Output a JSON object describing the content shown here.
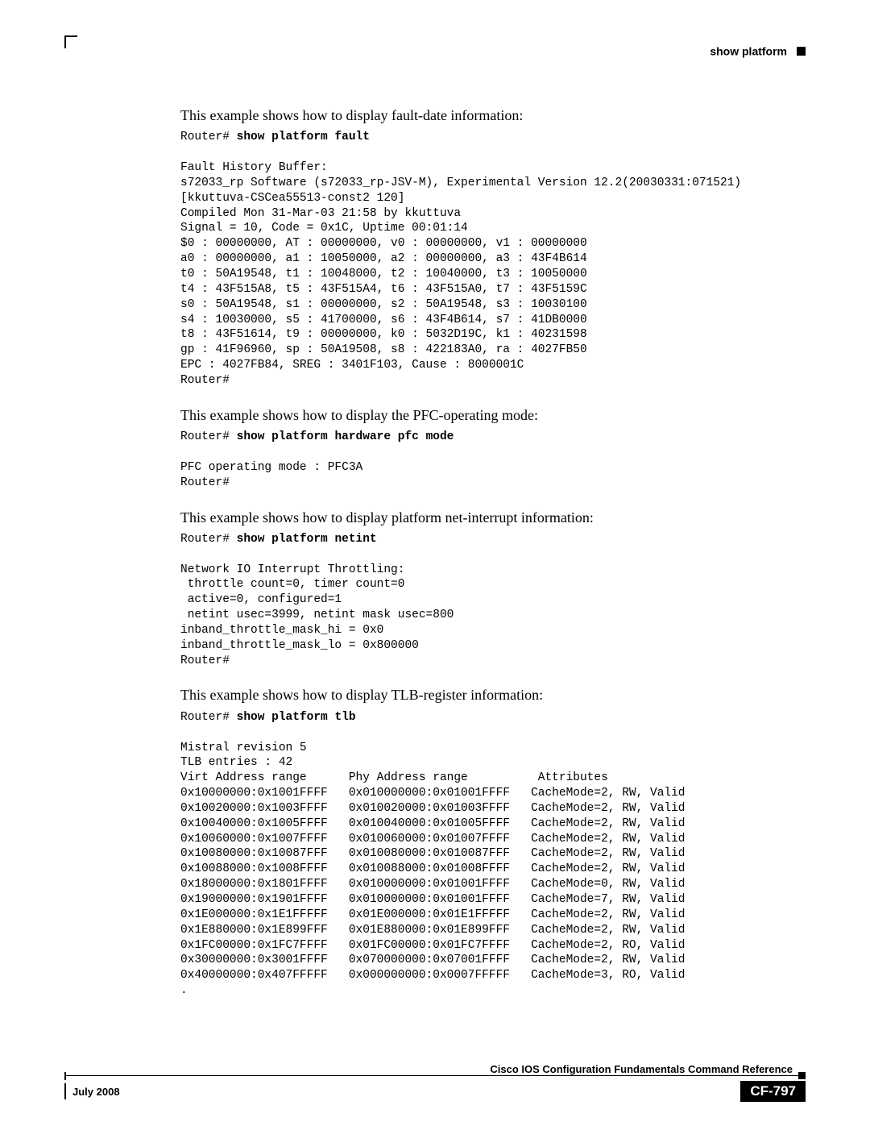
{
  "header": {
    "section": "show platform"
  },
  "paras": {
    "p1": "This example shows how to display fault-date information:",
    "p2": "This example shows how to display the PFC-operating mode:",
    "p3": "This example shows how to display platform net-interrupt information:",
    "p4": "This example shows how to display TLB-register information:"
  },
  "cmds": {
    "c1_prompt": "Router# ",
    "c1_bold": "show platform fault",
    "c2_prompt": "Router# ",
    "c2_bold": "show platform hardware pfc mode",
    "c3_prompt": "Router# ",
    "c3_bold": "show platform netint",
    "c4_prompt": "Router# ",
    "c4_bold": "show platform tlb"
  },
  "outputs": {
    "o1": "Fault History Buffer:\ns72033_rp Software (s72033_rp-JSV-M), Experimental Version 12.2(20030331:071521)\n[kkuttuva-CSCea55513-const2 120]\nCompiled Mon 31-Mar-03 21:58 by kkuttuva\nSignal = 10, Code = 0x1C, Uptime 00:01:14\n$0 : 00000000, AT : 00000000, v0 : 00000000, v1 : 00000000\na0 : 00000000, a1 : 10050000, a2 : 00000000, a3 : 43F4B614\nt0 : 50A19548, t1 : 10048000, t2 : 10040000, t3 : 10050000\nt4 : 43F515A8, t5 : 43F515A4, t6 : 43F515A0, t7 : 43F5159C\ns0 : 50A19548, s1 : 00000000, s2 : 50A19548, s3 : 10030100\ns4 : 10030000, s5 : 41700000, s6 : 43F4B614, s7 : 41DB0000\nt8 : 43F51614, t9 : 00000000, k0 : 5032D19C, k1 : 40231598\ngp : 41F96960, sp : 50A19508, s8 : 422183A0, ra : 4027FB50\nEPC : 4027FB84, SREG : 3401F103, Cause : 8000001C\nRouter#",
    "o2": "PFC operating mode : PFC3A\nRouter#",
    "o3": "Network IO Interrupt Throttling:\n throttle count=0, timer count=0\n active=0, configured=1\n netint usec=3999, netint mask usec=800\ninband_throttle_mask_hi = 0x0\ninband_throttle_mask_lo = 0x800000\nRouter#",
    "o4": "Mistral revision 5\nTLB entries : 42\nVirt Address range      Phy Address range          Attributes\n0x10000000:0x1001FFFF   0x010000000:0x01001FFFF   CacheMode=2, RW, Valid\n0x10020000:0x1003FFFF   0x010020000:0x01003FFFF   CacheMode=2, RW, Valid\n0x10040000:0x1005FFFF   0x010040000:0x01005FFFF   CacheMode=2, RW, Valid\n0x10060000:0x1007FFFF   0x010060000:0x01007FFFF   CacheMode=2, RW, Valid\n0x10080000:0x10087FFF   0x010080000:0x010087FFF   CacheMode=2, RW, Valid\n0x10088000:0x1008FFFF   0x010088000:0x01008FFFF   CacheMode=2, RW, Valid\n0x18000000:0x1801FFFF   0x010000000:0x01001FFFF   CacheMode=0, RW, Valid\n0x19000000:0x1901FFFF   0x010000000:0x01001FFFF   CacheMode=7, RW, Valid\n0x1E000000:0x1E1FFFFF   0x01E000000:0x01E1FFFFF   CacheMode=2, RW, Valid\n0x1E880000:0x1E899FFF   0x01E880000:0x01E899FFF   CacheMode=2, RW, Valid\n0x1FC00000:0x1FC7FFFF   0x01FC00000:0x01FC7FFFF   CacheMode=2, RO, Valid\n0x30000000:0x3001FFFF   0x070000000:0x07001FFFF   CacheMode=2, RW, Valid\n0x40000000:0x407FFFFF   0x000000000:0x0007FFFFF   CacheMode=3, RO, Valid\n."
  },
  "footer": {
    "book": "Cisco IOS Configuration Fundamentals Command Reference",
    "date": "July 2008",
    "pagenum": "CF-797"
  }
}
